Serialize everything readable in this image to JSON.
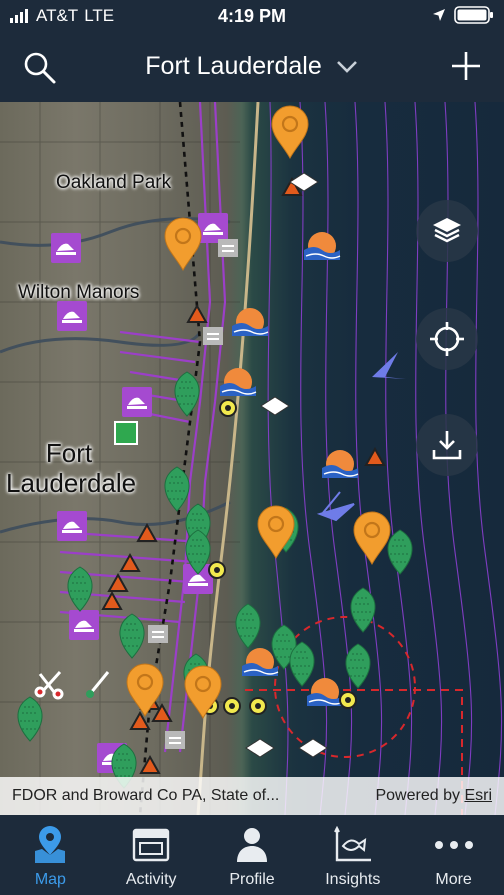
{
  "status_bar": {
    "carrier": "AT&T",
    "network": "LTE",
    "time": "4:19 PM"
  },
  "header": {
    "title": "Fort Lauderdale"
  },
  "map": {
    "labels": {
      "oakland_park": "Oakland Park",
      "wilton_manors": "Wilton Manors",
      "fort_lauderdale": "Fort Lauderdale"
    },
    "attribution": "FDOR and Broward Co PA, State of...",
    "powered_by_prefix": "Powered by",
    "powered_by_link": "Esri"
  },
  "tabs": [
    {
      "label": "Map",
      "icon": "map-pin-icon",
      "active": true
    },
    {
      "label": "Activity",
      "icon": "activity-icon",
      "active": false
    },
    {
      "label": "Profile",
      "icon": "profile-icon",
      "active": false
    },
    {
      "label": "Insights",
      "icon": "insights-icon",
      "active": false
    },
    {
      "label": "More",
      "icon": "more-icon",
      "active": false
    }
  ],
  "colors": {
    "bar_background": "#1d2b3b",
    "active_tab": "#3c9bea",
    "pin_orange": "#f29d2e",
    "reef_green": "#2f9e5c",
    "boundary_purple": "#9b3fc8"
  }
}
